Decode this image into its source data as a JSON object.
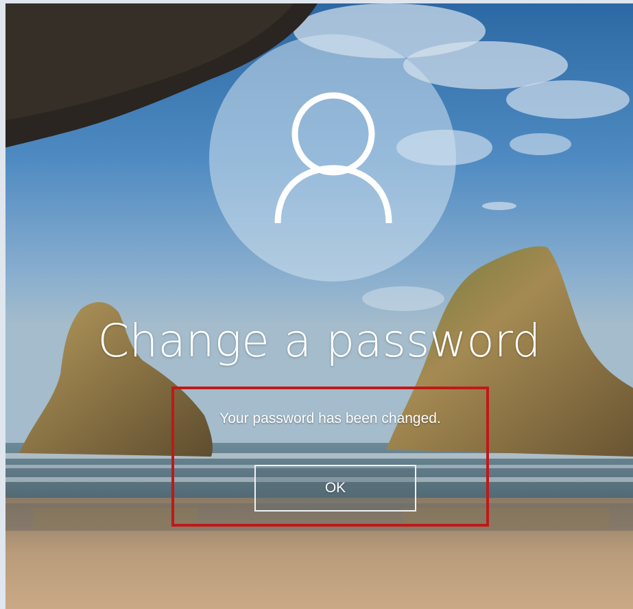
{
  "screen": {
    "title": "Change a password",
    "message": "Your password has been changed.",
    "ok_button_label": "OK"
  },
  "icons": {
    "avatar": "user-icon"
  },
  "colors": {
    "highlight_border": "#c01818",
    "text": "#ffffff"
  }
}
